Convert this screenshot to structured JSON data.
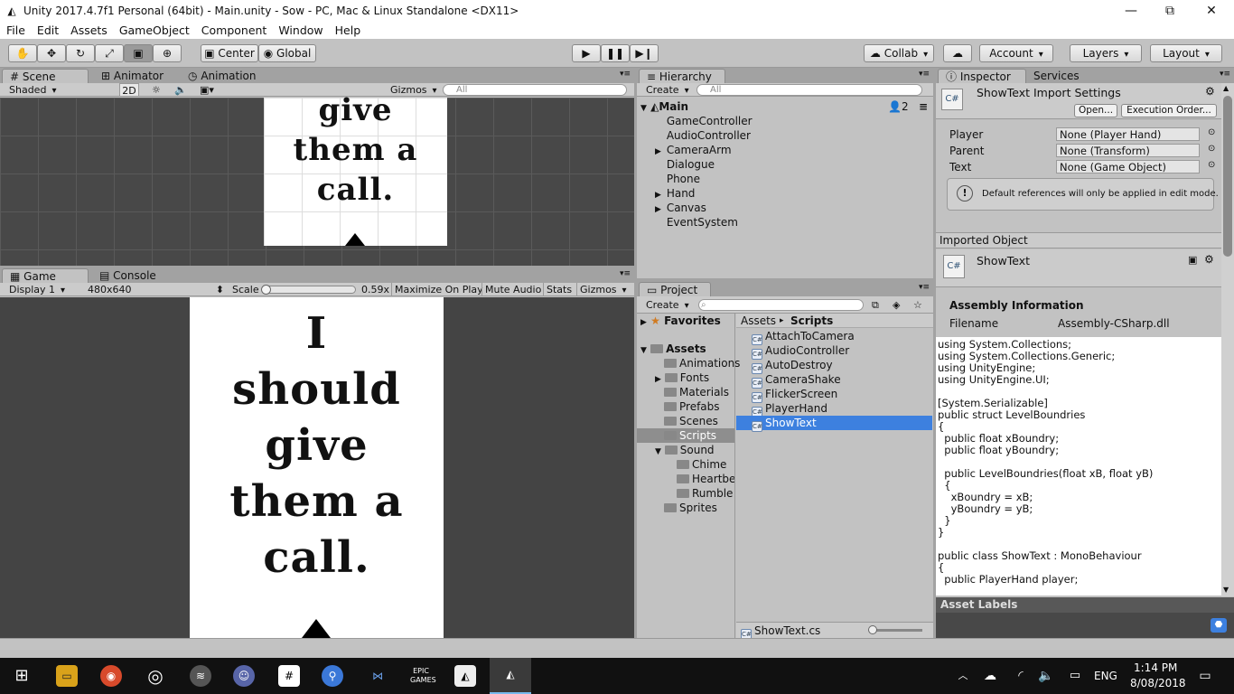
{
  "window": {
    "title": "Unity 2017.4.7f1 Personal (64bit) - Main.unity - Sow - PC, Mac & Linux Standalone <DX11>",
    "minimize": "—",
    "maximize": "⧉",
    "close": "✕"
  },
  "menu": [
    "File",
    "Edit",
    "Assets",
    "GameObject",
    "Component",
    "Window",
    "Help"
  ],
  "toolbar": {
    "center": "Center",
    "global": "Global",
    "collab": "Collab",
    "account": "Account",
    "layers": "Layers",
    "layout": "Layout"
  },
  "scene": {
    "tab_scene": "Scene",
    "tab_animator": "Animator",
    "tab_animation": "Animation",
    "shaded": "Shaded",
    "mode2d": "2D",
    "gizmos": "Gizmos",
    "search": "All",
    "lines": [
      "give",
      "them a",
      "call."
    ]
  },
  "game": {
    "tab_game": "Game",
    "tab_console": "Console",
    "display": "Display 1",
    "resolution": "480x640",
    "scale_label": "Scale",
    "scale_value": "0.59x",
    "maximize": "Maximize On Play",
    "mute": "Mute Audio",
    "stats": "Stats",
    "gizmos": "Gizmos",
    "lines": [
      "I",
      "should",
      "give",
      "them a",
      "call."
    ]
  },
  "hierarchy": {
    "tab": "Hierarchy",
    "create": "Create",
    "search": "All",
    "scene_name": "Main",
    "users": "2",
    "items": [
      {
        "label": "GameController",
        "arrow": ""
      },
      {
        "label": "AudioController",
        "arrow": ""
      },
      {
        "label": "CameraArm",
        "arrow": "▶"
      },
      {
        "label": "Dialogue",
        "arrow": ""
      },
      {
        "label": "Phone",
        "arrow": ""
      },
      {
        "label": "Hand",
        "arrow": "▶"
      },
      {
        "label": "Canvas",
        "arrow": "▶"
      },
      {
        "label": "EventSystem",
        "arrow": ""
      }
    ]
  },
  "project": {
    "tab": "Project",
    "create": "Create",
    "favorites": "Favorites",
    "assets": "Assets",
    "folders": [
      "Animations",
      "Fonts",
      "Materials",
      "Prefabs",
      "Scenes",
      "Scripts",
      "Sound",
      "Chime",
      "Heartbe",
      "Rumble",
      "Sprites"
    ],
    "breadcrumb_root": "Assets",
    "breadcrumb_sep": "▸",
    "breadcrumb_current": "Scripts",
    "scripts": [
      "AttachToCamera",
      "AudioController",
      "AutoDestroy",
      "CameraShake",
      "FlickerScreen",
      "PlayerHand",
      "ShowText"
    ],
    "selected_file": "ShowText.cs"
  },
  "inspector": {
    "tab": "Inspector",
    "services": "Services",
    "title": "ShowText Import Settings",
    "open": "Open...",
    "exec_order": "Execution Order...",
    "fields": [
      {
        "label": "Player",
        "value": "None (Player Hand)"
      },
      {
        "label": "Parent",
        "value": "None (Transform)"
      },
      {
        "label": "Text",
        "value": "None (Game Object)"
      }
    ],
    "note": "Default references will only be applied in edit mode.",
    "imported_object": "Imported Object",
    "script_name": "ShowText",
    "assembly_info": "Assembly Information",
    "filename_label": "Filename",
    "filename_value": "Assembly-CSharp.dll",
    "code": "using System.Collections;\nusing System.Collections.Generic;\nusing UnityEngine;\nusing UnityEngine.UI;\n\n[System.Serializable]\npublic struct LevelBoundries\n{\n  public float xBoundry;\n  public float yBoundry;\n\n  public LevelBoundries(float xB, float yB)\n  {\n    xBoundry = xB;\n    yBoundry = yB;\n  }\n}\n\npublic class ShowText : MonoBehaviour\n{\n  public PlayerHand player;",
    "asset_labels": "Asset Labels"
  },
  "taskbar": {
    "lang": "ENG",
    "time": "1:14 PM",
    "date": "8/08/2018"
  },
  "colors": {
    "selection": "#3d80df",
    "panel": "#c2c2c2",
    "dark": "#444444",
    "taskbar": "#111111"
  }
}
